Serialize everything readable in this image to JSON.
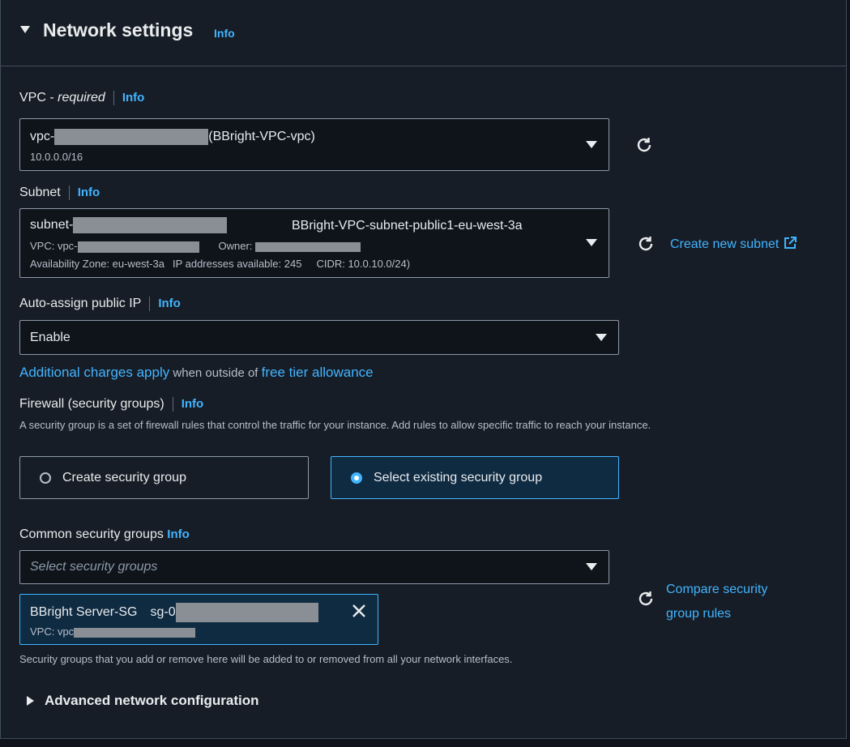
{
  "section": {
    "title": "Network settings",
    "info": "Info"
  },
  "vpc": {
    "label_main": "VPC - ",
    "label_req": "required",
    "info": "Info",
    "prefix": "vpc-",
    "name": "(BBright-VPC-vpc)",
    "cidr": "10.0.0.0/16"
  },
  "subnet": {
    "label": "Subnet",
    "info": "Info",
    "prefix": "subnet-",
    "name": "BBright-VPC-subnet-public1-eu-west-3a",
    "vpc_label": "VPC: vpc-",
    "owner_label": "Owner:",
    "az": "Availability Zone: eu-west-3a",
    "ips": "IP addresses available: 245",
    "cidr": "CIDR: 10.0.10.0/24)",
    "create_link": "Create new subnet"
  },
  "public_ip": {
    "label": "Auto-assign public IP",
    "info": "Info",
    "value": "Enable"
  },
  "charges": {
    "link1": "Additional charges apply",
    "text": " when outside of ",
    "link2": "free tier allowance"
  },
  "firewall": {
    "label": "Firewall (security groups)",
    "info": "Info",
    "desc": "A security group is a set of firewall rules that control the traffic for your instance. Add rules to allow specific traffic to reach your instance.",
    "option_create": "Create security group",
    "option_select": "Select existing security group",
    "selected": "select"
  },
  "common_sg": {
    "label": "Common security groups",
    "info": "Info",
    "placeholder": "Select security groups",
    "token_name": "BBright Server-SG",
    "token_id": "sg-0",
    "token_vpc": "VPC: vpc",
    "compare_link_1": "Compare security",
    "compare_link_2": "group rules",
    "note": "Security groups that you add or remove here will be added to or removed from all your network interfaces."
  },
  "advanced": {
    "label": "Advanced network configuration"
  },
  "colors": {
    "accent": "#42b4ff",
    "bg": "#161d26"
  }
}
